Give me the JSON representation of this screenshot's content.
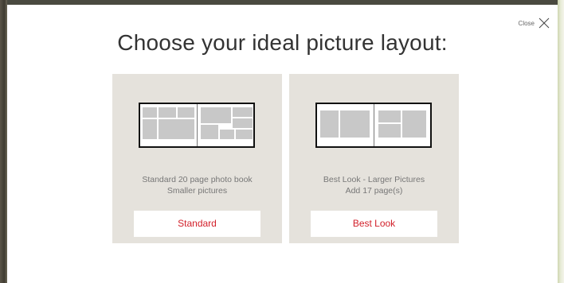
{
  "modal": {
    "title": "Choose your ideal picture layout:",
    "close_label": "Close"
  },
  "options": [
    {
      "line1": "Standard 20 page photo book",
      "line2": "Smaller pictures",
      "button_label": "Standard"
    },
    {
      "line1": "Best Look - Larger Pictures",
      "line2": "Add 17 page(s)",
      "button_label": "Best Look"
    }
  ],
  "colors": {
    "button_text": "#d2202a",
    "card_background": "#e5e2dc",
    "photo_placeholder": "#c8c8c8"
  },
  "icons": [
    "close-icon",
    "standard-layout-preview",
    "best-look-layout-preview"
  ]
}
